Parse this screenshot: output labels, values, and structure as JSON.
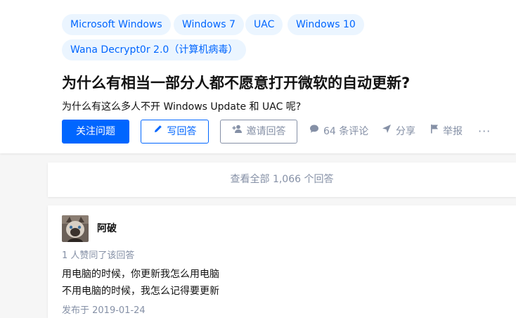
{
  "topics": [
    "Microsoft Windows",
    "Windows 7",
    "UAC",
    "Windows 10",
    "Wana Decrypt0r 2.0（计算机病毒）"
  ],
  "question": {
    "title": "为什么有相当一部分人都不愿意打开微软的自动更新?",
    "detail": "为什么有这么多人不开 Windows Update 和 UAC 呢?"
  },
  "actions": {
    "follow": "关注问题",
    "write_answer": "写回答",
    "invite": "邀请回答",
    "comments": "64 条评论",
    "share": "分享",
    "report": "举报",
    "more": "···"
  },
  "view_all": "查看全部 1,066 个回答",
  "answer": {
    "author": "阿破",
    "votes": "1 人赞同了该回答",
    "lines": [
      "用电脑的时候，你更新我怎么用电脑",
      "不用电脑的时候，我怎么记得要更新"
    ],
    "edited": "发布于 2019-01-24"
  },
  "colors": {
    "brand": "#0066ff",
    "tag_bg": "#ebf5ff",
    "muted": "#8590a6"
  },
  "icons": [
    "pencil-icon",
    "add-person-icon",
    "comment-icon",
    "share-icon",
    "flag-icon",
    "more-icon"
  ]
}
